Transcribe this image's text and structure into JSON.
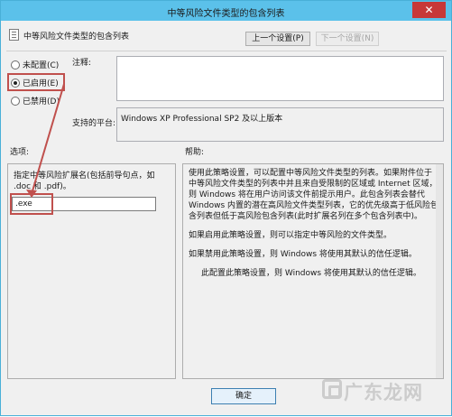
{
  "window": {
    "title": "中等风险文件类型的包含列表",
    "close_glyph": "✕"
  },
  "header": {
    "policy_name": "中等风险文件类型的包含列表",
    "prev_button": "上一个设置(P)",
    "next_button": "下一个设置(N)"
  },
  "state": {
    "options": [
      {
        "label": "未配置(C)",
        "selected": false
      },
      {
        "label": "已启用(E)",
        "selected": true
      },
      {
        "label": "已禁用(D)",
        "selected": false
      }
    ]
  },
  "labels": {
    "comment": "注释:",
    "platform": "支持的平台:",
    "options": "选项:",
    "help": "帮助:"
  },
  "comment_value": "",
  "platform_value": "Windows XP Professional SP2 及以上版本",
  "options_panel": {
    "description": "指定中等风险扩展名(包括前导句点，如 .doc 和 .pdf)。",
    "extensions_value": ".exe"
  },
  "help_panel": {
    "paragraphs": [
      "使用此策略设置，可以配置中等风险文件类型的列表。如果附件位于中等风险文件类型的列表中并且来自受限制的区域或 Internet 区域，则 Windows 将在用户访问该文件前提示用户。此包含列表会替代 Windows 内置的潜在高风险文件类型列表，它的优先级高于低风险包含列表但低于高风险包含列表(此时扩展名列在多个包含列表中)。",
      "如果启用此策略设置，则可以指定中等风险的文件类型。",
      "如果禁用此策略设置，则 Windows 将使用其默认的信任逻辑。",
      "此配置此策略设置，则 Windows 将使用其默认的信任逻辑。"
    ]
  },
  "footer": {
    "ok_button": "确定"
  },
  "watermark": {
    "text": "广东龙网"
  },
  "colors": {
    "titlebar": "#5bc1ea",
    "highlight": "#c0504d",
    "close": "#c73838"
  }
}
